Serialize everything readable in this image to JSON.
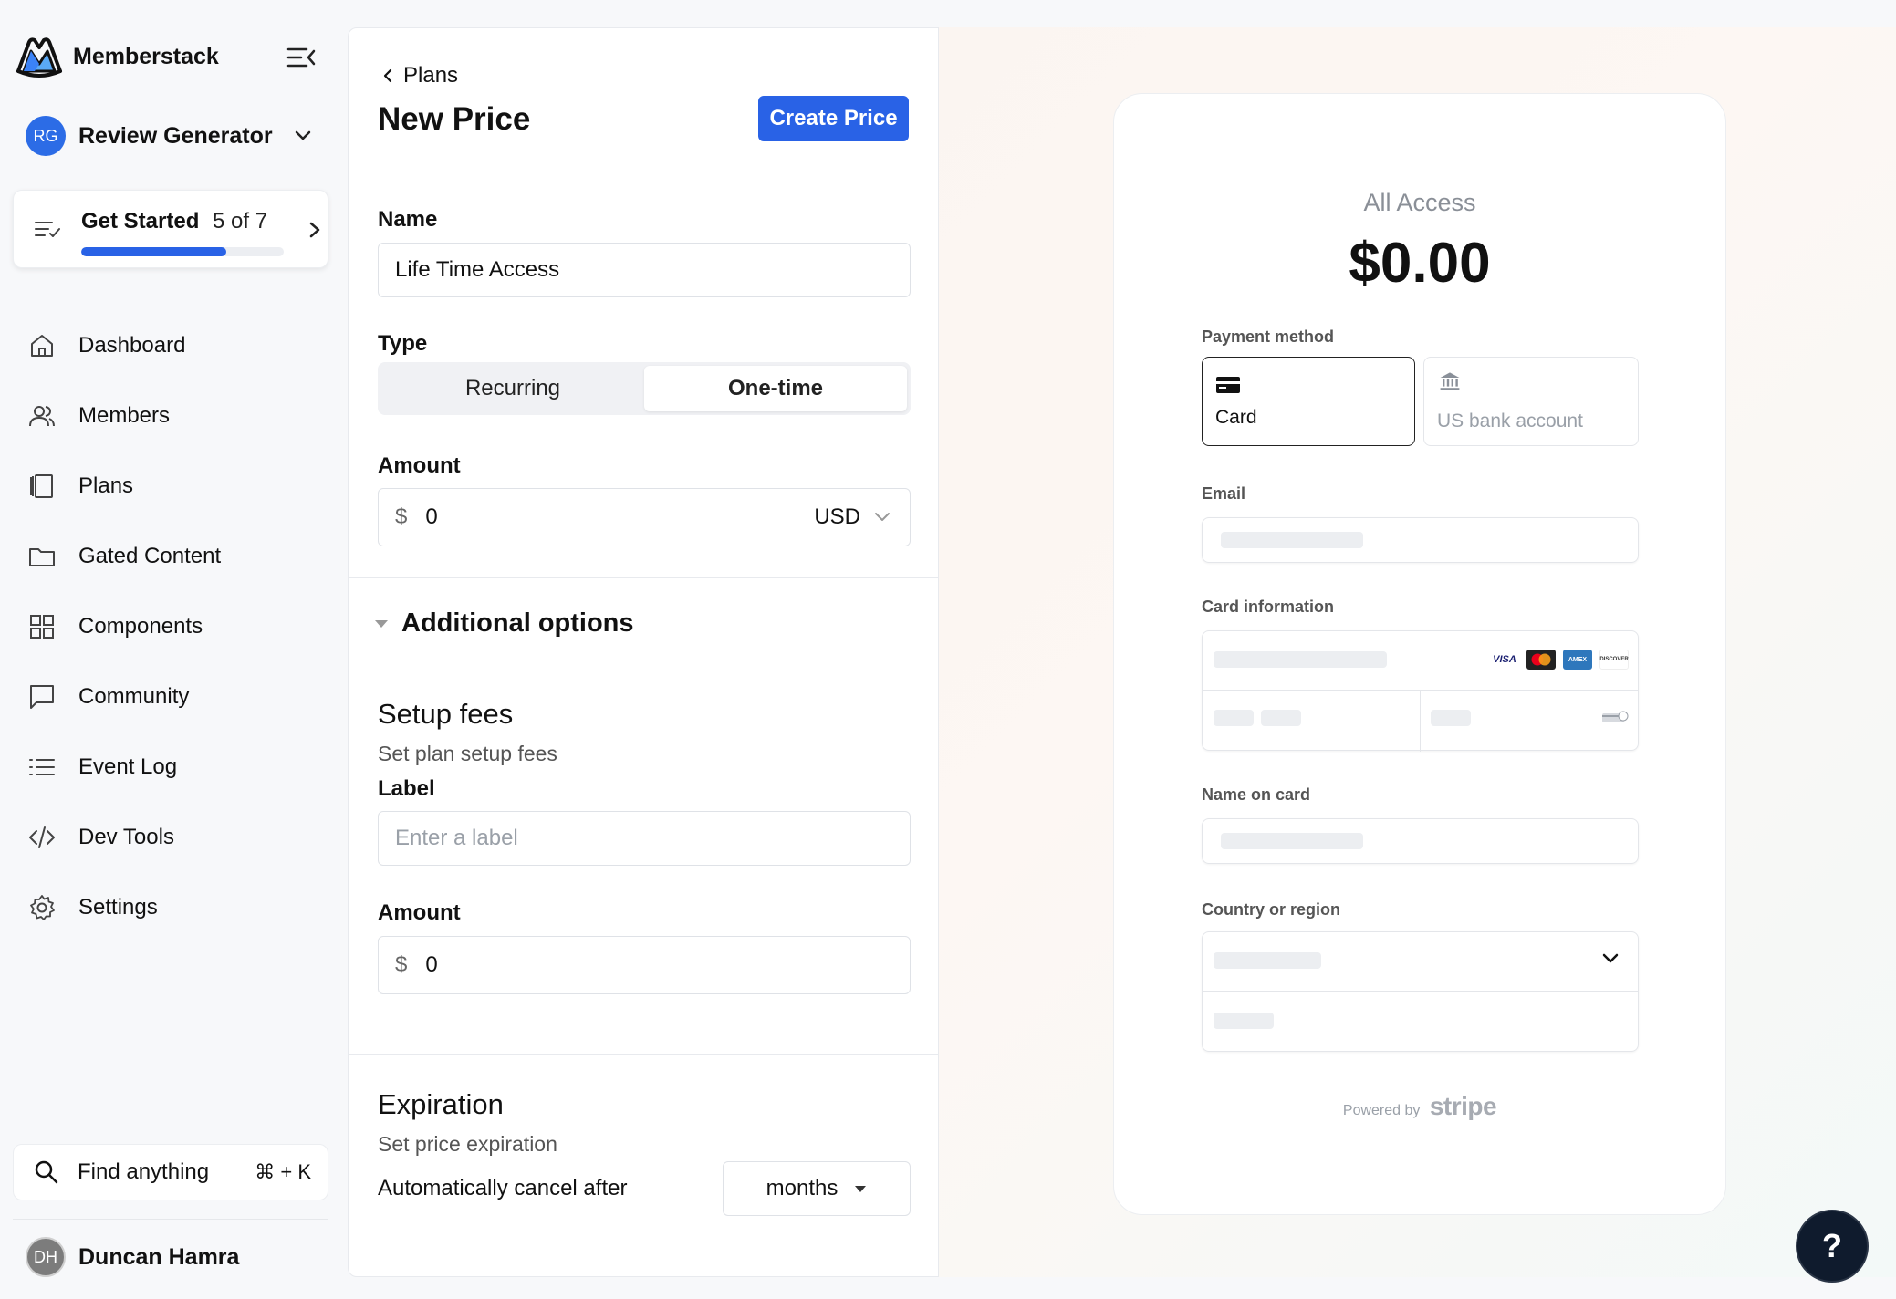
{
  "brand": {
    "name": "Memberstack"
  },
  "workspace": {
    "initials": "RG",
    "name": "Review Generator"
  },
  "get_started": {
    "title": "Get Started",
    "count": "5 of 7",
    "progress": 0.714
  },
  "nav": [
    {
      "label": "Dashboard",
      "icon": "home-icon"
    },
    {
      "label": "Members",
      "icon": "users-icon"
    },
    {
      "label": "Plans",
      "icon": "plans-icon"
    },
    {
      "label": "Gated Content",
      "icon": "folder-icon"
    },
    {
      "label": "Components",
      "icon": "grid-icon"
    },
    {
      "label": "Community",
      "icon": "chat-icon"
    },
    {
      "label": "Event Log",
      "icon": "list-icon"
    },
    {
      "label": "Dev Tools",
      "icon": "code-icon"
    },
    {
      "label": "Settings",
      "icon": "gear-icon"
    }
  ],
  "search": {
    "label": "Find anything",
    "shortcut": "⌘ + K"
  },
  "user": {
    "initials": "DH",
    "name": "Duncan Hamra"
  },
  "form": {
    "breadcrumb": "Plans",
    "title": "New Price",
    "create_label": "Create Price",
    "name_label": "Name",
    "name_value": "Life Time Access",
    "type_label": "Type",
    "type_options": [
      "Recurring",
      "One-time"
    ],
    "type_selected": "One-time",
    "amount_label": "Amount",
    "currency_symbol": "$",
    "amount_value": "0",
    "currency": "USD",
    "additional_label": "Additional options",
    "setup": {
      "title": "Setup fees",
      "subtitle": "Set plan setup fees",
      "label_label": "Label",
      "label_placeholder": "Enter a label",
      "amount_label": "Amount",
      "amount_value": "0"
    },
    "expiration": {
      "title": "Expiration",
      "subtitle": "Set price expiration",
      "auto_cancel_label": "Automatically cancel after",
      "unit": "months"
    }
  },
  "preview": {
    "plan_name": "All Access",
    "price": "$0.00",
    "payment_method_label": "Payment method",
    "methods": [
      "Card",
      "US bank account"
    ],
    "email_label": "Email",
    "card_info_label": "Card information",
    "card_brands": [
      "VISA",
      "Mastercard",
      "AMEX",
      "DISCOVER"
    ],
    "name_on_card_label": "Name on card",
    "country_label": "Country or region",
    "powered_by": "Powered by",
    "stripe": "stripe"
  },
  "help": {
    "label": "?"
  },
  "colors": {
    "accent": "#2962e6",
    "help_bg": "#0f1b2d"
  }
}
